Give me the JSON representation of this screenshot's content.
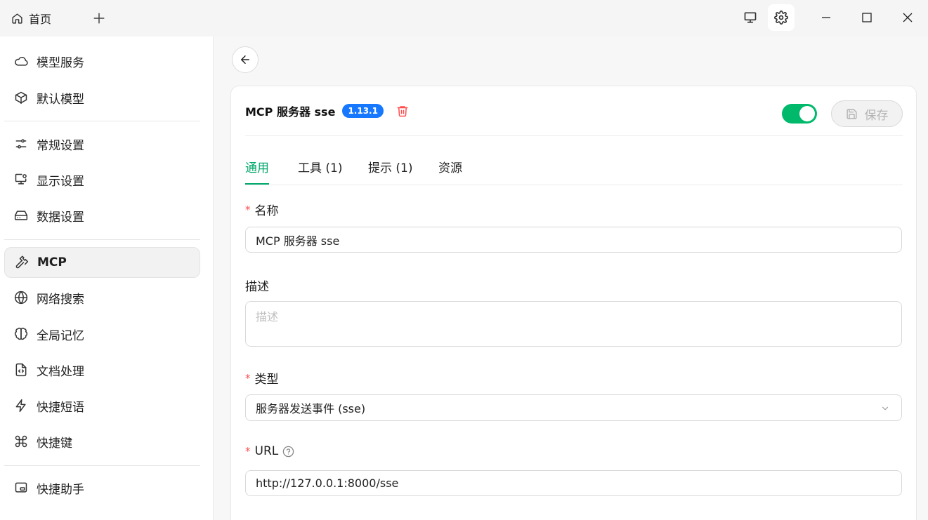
{
  "titlebar": {
    "home_tab_label": "首页",
    "icons": [
      "home-icon",
      "plus-icon",
      "monitor-icon",
      "gear-icon",
      "minimize-icon",
      "maximize-icon",
      "close-icon"
    ]
  },
  "sidebar": {
    "items": [
      {
        "label": "模型服务",
        "icon": "cloud-icon"
      },
      {
        "label": "默认模型",
        "icon": "cube-icon"
      },
      {
        "label": "常规设置",
        "icon": "sliders-icon"
      },
      {
        "label": "显示设置",
        "icon": "monitor-settings-icon"
      },
      {
        "label": "数据设置",
        "icon": "hard-drive-icon"
      },
      {
        "label": "MCP",
        "icon": "hammer-icon",
        "active": true
      },
      {
        "label": "网络搜索",
        "icon": "globe-icon"
      },
      {
        "label": "全局记忆",
        "icon": "brain-icon"
      },
      {
        "label": "文档处理",
        "icon": "file-code-icon"
      },
      {
        "label": "快捷短语",
        "icon": "zap-icon"
      },
      {
        "label": "快捷键",
        "icon": "command-icon"
      },
      {
        "label": "快捷助手",
        "icon": "app-window-icon"
      }
    ]
  },
  "server": {
    "title": "MCP 服务器 sse",
    "version": "1.13.1",
    "enabled": true,
    "save_label": "保存"
  },
  "tabs": [
    {
      "label": "通用",
      "active": true
    },
    {
      "label": "工具 (1)"
    },
    {
      "label": "提示 (1)"
    },
    {
      "label": "资源"
    }
  ],
  "form": {
    "required_mark": "*",
    "name_label": "名称",
    "name_value": "MCP 服务器 sse",
    "desc_label": "描述",
    "desc_placeholder": "描述",
    "type_label": "类型",
    "type_value": "服务器发送事件 (sse)",
    "url_label": "URL",
    "url_value": "http://127.0.0.1:8000/sse"
  },
  "colors": {
    "accent": "#00a86b",
    "toggle_on": "#00b96b",
    "badge": "#1677ff",
    "danger": "#ff4d4f"
  }
}
